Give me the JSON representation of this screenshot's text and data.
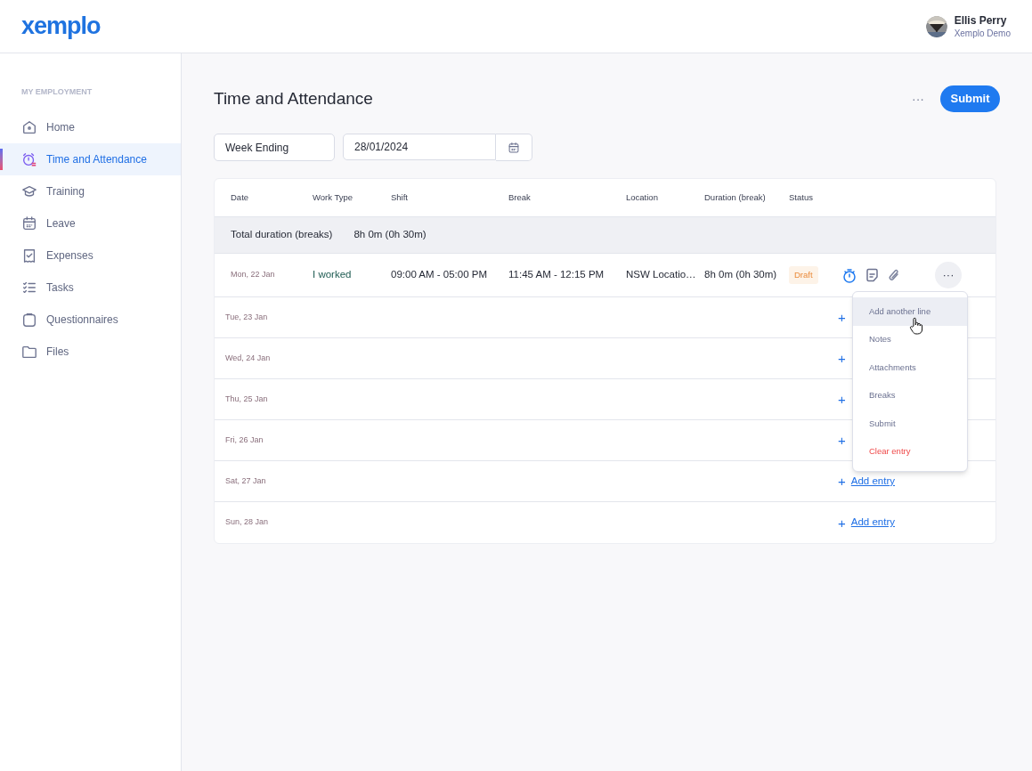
{
  "header": {
    "logo": "xemplo",
    "user": {
      "name": "Ellis Perry",
      "company": "Xemplo Demo"
    }
  },
  "sidebar": {
    "section": "MY EMPLOYMENT",
    "items": [
      {
        "label": "Home",
        "selected": false
      },
      {
        "label": "Time and Attendance",
        "selected": true
      },
      {
        "label": "Training",
        "selected": false
      },
      {
        "label": "Leave",
        "selected": false
      },
      {
        "label": "Expenses",
        "selected": false
      },
      {
        "label": "Tasks",
        "selected": false
      },
      {
        "label": "Questionnaires",
        "selected": false
      },
      {
        "label": "Files",
        "selected": false
      }
    ]
  },
  "page": {
    "title": "Time and Attendance",
    "more": "···",
    "submit": "Submit"
  },
  "filters": {
    "period": "Week Ending",
    "date": "28/01/2024"
  },
  "table": {
    "columns": [
      "Date",
      "Work Type",
      "Shift",
      "Break",
      "Location",
      "Duration (break)",
      "Status"
    ],
    "total": {
      "label": "Total duration (breaks)",
      "value": "8h 0m (0h 30m)"
    },
    "rows": [
      {
        "kind": "entry",
        "date": "Mon, 22 Jan",
        "work_type": "I worked",
        "shift": "09:00 AM - 05:00 PM",
        "break": "11:45 AM - 12:15 PM",
        "location": "NSW Locatio…",
        "duration": "8h 0m (0h 30m)",
        "status": "Draft",
        "more": "···"
      },
      {
        "kind": "empty",
        "date": "Tue, 23 Jan",
        "plus": "+"
      },
      {
        "kind": "empty",
        "date": "Wed, 24 Jan",
        "plus": "+"
      },
      {
        "kind": "empty",
        "date": "Thu, 25 Jan",
        "plus": "+"
      },
      {
        "kind": "empty",
        "date": "Fri, 26 Jan",
        "plus": "+"
      },
      {
        "kind": "empty",
        "date": "Sat, 27 Jan",
        "plus": "+",
        "add": "Add entry"
      },
      {
        "kind": "empty",
        "date": "Sun, 28 Jan",
        "plus": "+",
        "add": "Add entry"
      }
    ]
  },
  "menu": {
    "items": [
      {
        "label": "Add another line",
        "selected": true,
        "kind": "normal"
      },
      {
        "label": "Notes",
        "selected": false,
        "kind": "normal"
      },
      {
        "label": "Attachments",
        "selected": false,
        "kind": "normal"
      },
      {
        "label": "Breaks",
        "selected": false,
        "kind": "normal"
      },
      {
        "label": "Submit",
        "selected": false,
        "kind": "normal"
      },
      {
        "label": "Clear entry",
        "selected": false,
        "kind": "danger"
      }
    ]
  }
}
